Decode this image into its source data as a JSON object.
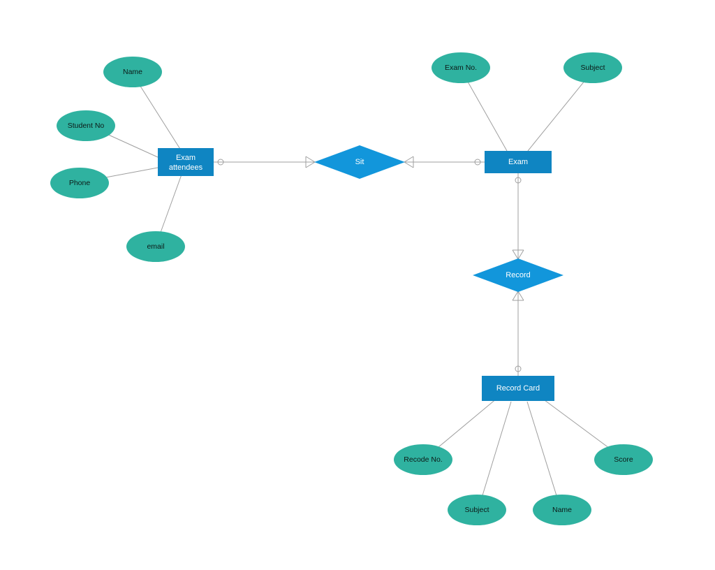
{
  "entities": {
    "exam_attendees": {
      "label_line1": "Exam",
      "label_line2": "attendees"
    },
    "exam": {
      "label": "Exam"
    },
    "record_card": {
      "label": "Record Card"
    }
  },
  "relationships": {
    "sit": {
      "label": "Sit"
    },
    "record": {
      "label": "Record"
    }
  },
  "attributes": {
    "ea_name": {
      "label": "Name"
    },
    "ea_student_no": {
      "label": "Student No"
    },
    "ea_phone": {
      "label": "Phone"
    },
    "ea_email": {
      "label": "email"
    },
    "ex_exam_no": {
      "label": "Exam No."
    },
    "ex_subject": {
      "label": "Subject"
    },
    "rc_recode_no": {
      "label": "Recode No."
    },
    "rc_subject": {
      "label": "Subject"
    },
    "rc_name": {
      "label": "Name"
    },
    "rc_score": {
      "label": "Score"
    }
  },
  "colors": {
    "entity_fill": "#0f85c2",
    "relationship_fill": "#1296db",
    "attribute_fill": "#2fb2a0",
    "connector_stroke": "#9f9f9f"
  }
}
